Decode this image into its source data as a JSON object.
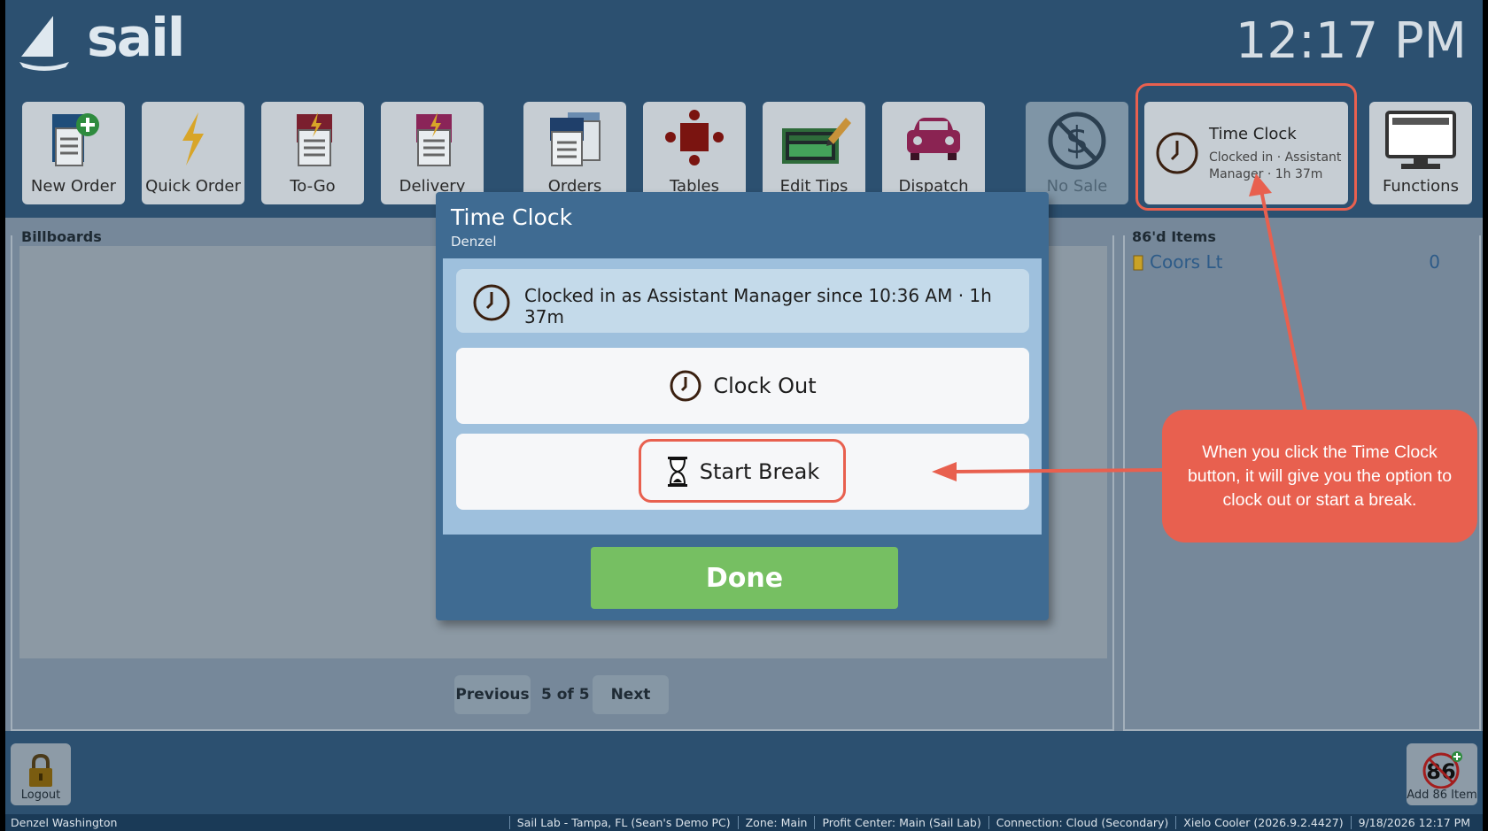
{
  "app": {
    "logo": "sail",
    "clock": "12:17 PM"
  },
  "toolbar": [
    {
      "label": "New Order",
      "icon": "new-order-icon"
    },
    {
      "label": "Quick Order",
      "icon": "lightning-icon"
    },
    {
      "label": "To-Go",
      "icon": "to-go-icon"
    },
    {
      "label": "Delivery",
      "icon": "delivery-icon"
    },
    {
      "label": "Orders",
      "icon": "orders-icon"
    },
    {
      "label": "Tables",
      "icon": "tables-icon"
    },
    {
      "label": "Edit Tips",
      "icon": "edit-tips-icon"
    },
    {
      "label": "Dispatch",
      "icon": "car-icon"
    },
    {
      "label": "No Sale",
      "icon": "no-sale-icon"
    },
    {
      "label": "Functions",
      "icon": "monitor-icon"
    }
  ],
  "time_clock_button": {
    "title": "Time Clock",
    "subtitle": "Clocked in · Assistant Manager · 1h 37m"
  },
  "billboards": {
    "title": "Billboards",
    "prev": "Previous",
    "next": "Next",
    "page": "5 of 5"
  },
  "items86": {
    "title": "86'd Items",
    "rows": [
      {
        "name": "Coors Lt",
        "count": "0"
      }
    ]
  },
  "footer": {
    "logout": "Logout",
    "add86": "Add 86 Item",
    "add86_badge": "86"
  },
  "statusbar": {
    "user": "Denzel Washington",
    "segments": [
      "Sail Lab - Tampa, FL (Sean's Demo PC)",
      "Zone: Main",
      "Profit Center: Main (Sail Lab)",
      "Connection: Cloud (Secondary)",
      "Xielo Cooler (2026.9.2.4427)",
      "9/18/2026 12:17 PM"
    ]
  },
  "dialog": {
    "title": "Time Clock",
    "subtitle": "Denzel",
    "info": "Clocked in as Assistant Manager since 10:36 AM · 1h 37m",
    "clock_out": "Clock Out",
    "start_break": "Start Break",
    "done": "Done"
  },
  "callout": {
    "text": "When you click the Time Clock button, it will give you the option to clock out or start a break."
  },
  "colors": {
    "accent": "#e8604f",
    "done": "#76bf62",
    "panel": "#2c5070"
  }
}
